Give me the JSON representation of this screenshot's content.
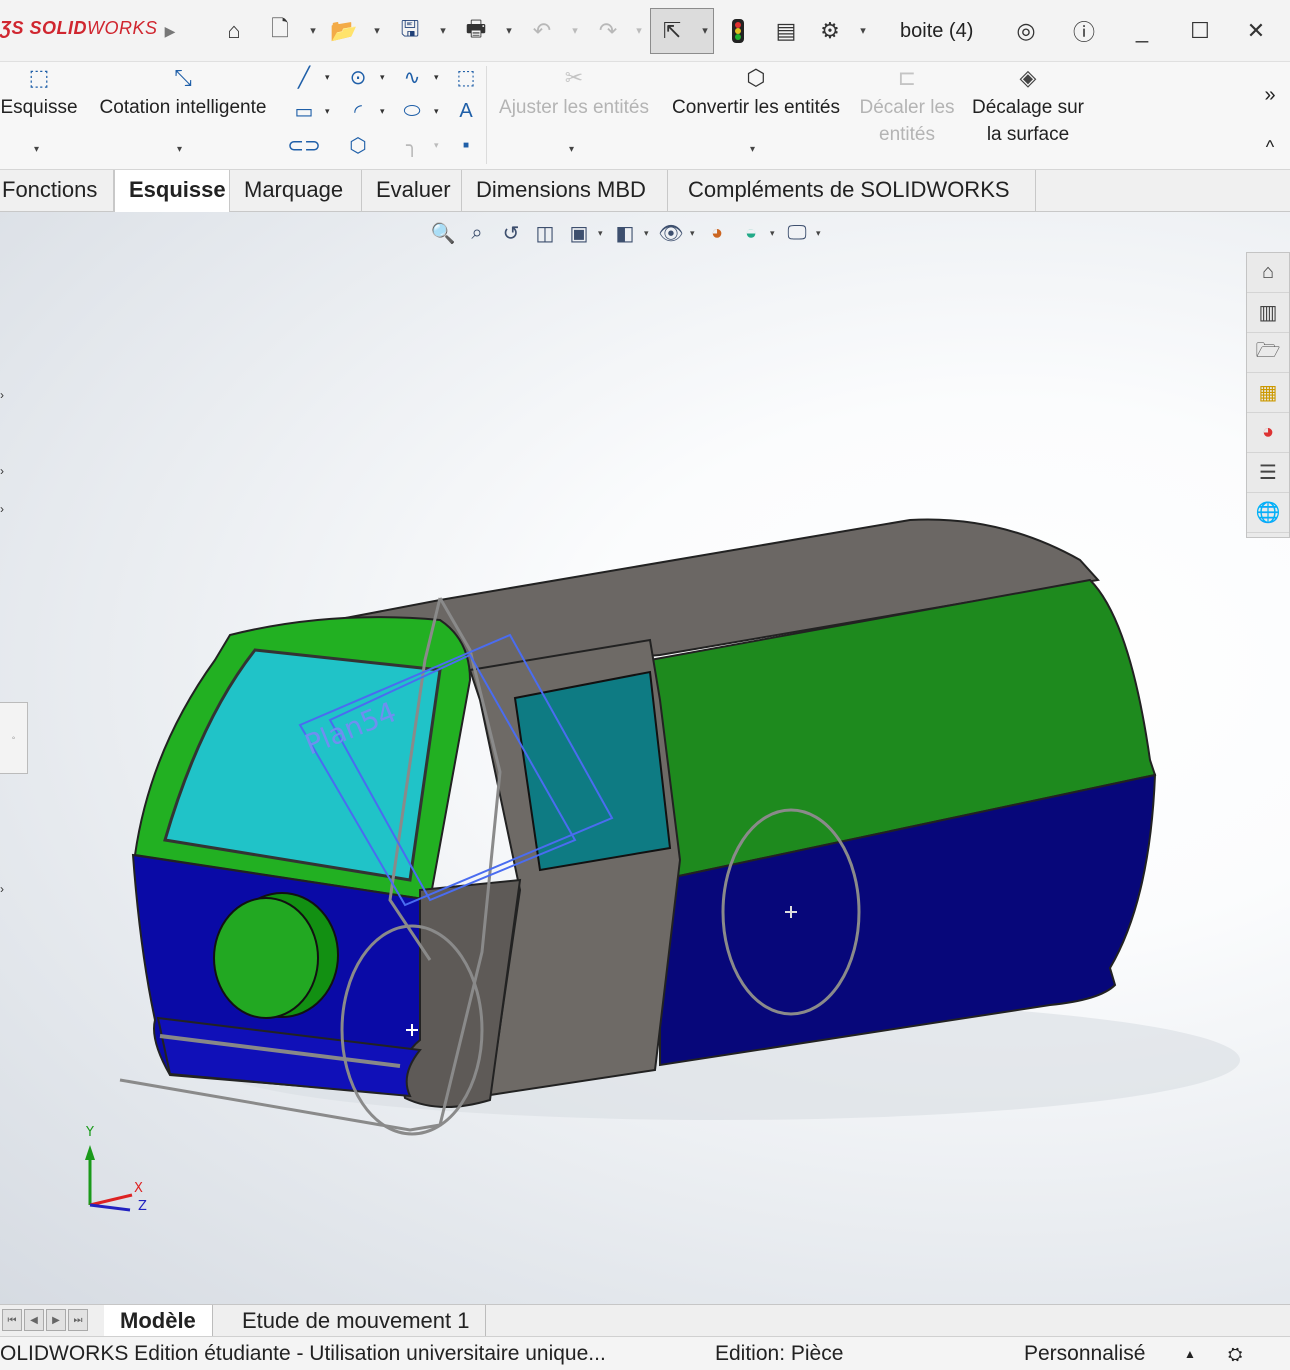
{
  "titlebar": {
    "logo_brand": "SOLIDWORKS",
    "doc_title": "boite (4)",
    "icons": [
      "expand-arrow-icon",
      "home-icon",
      "new-document-icon",
      "open-icon",
      "save-icon",
      "print-icon",
      "undo-icon",
      "redo-icon",
      "select-icon",
      "rebuild-icon",
      "file-properties-icon",
      "options-icon",
      "account-icon",
      "help-icon",
      "minimize-icon",
      "maximize-icon",
      "close-icon"
    ]
  },
  "ribbon": {
    "sketch": "Esquisse",
    "smart_dimension": "Cotation intelligente",
    "trim": "Ajuster les entités",
    "convert": "Convertir les entités",
    "offset_line1": "Décaler les",
    "offset_line2": "entités",
    "surface_offset_line1": "Décalage sur",
    "surface_offset_line2": "la surface",
    "more": "»",
    "collapse": "^"
  },
  "tabs": [
    {
      "label": "Fonctions"
    },
    {
      "label": "Esquisse"
    },
    {
      "label": "Marquage"
    },
    {
      "label": "Evaluer"
    },
    {
      "label": "Dimensions MBD"
    },
    {
      "label": "Compléments de SOLIDWORKS"
    }
  ],
  "viewport": {
    "plane_label": "Plan54",
    "axis_x": "X",
    "axis_y": "Y",
    "axis_z": "Z",
    "colors": {
      "body_blue": "#0a0a8c",
      "top_green": "#1e8a1e",
      "glass": "#1fb7c2",
      "gray": "#6e6a66"
    }
  },
  "bottom": {
    "model_tab": "Modèle",
    "motion_tab": "Etude de mouvement 1"
  },
  "status": {
    "left": "OLIDWORKS Edition étudiante - Utilisation universitaire unique...",
    "mid": "Edition: Pièce",
    "right": "Personnalisé",
    "arrow": "▲"
  }
}
